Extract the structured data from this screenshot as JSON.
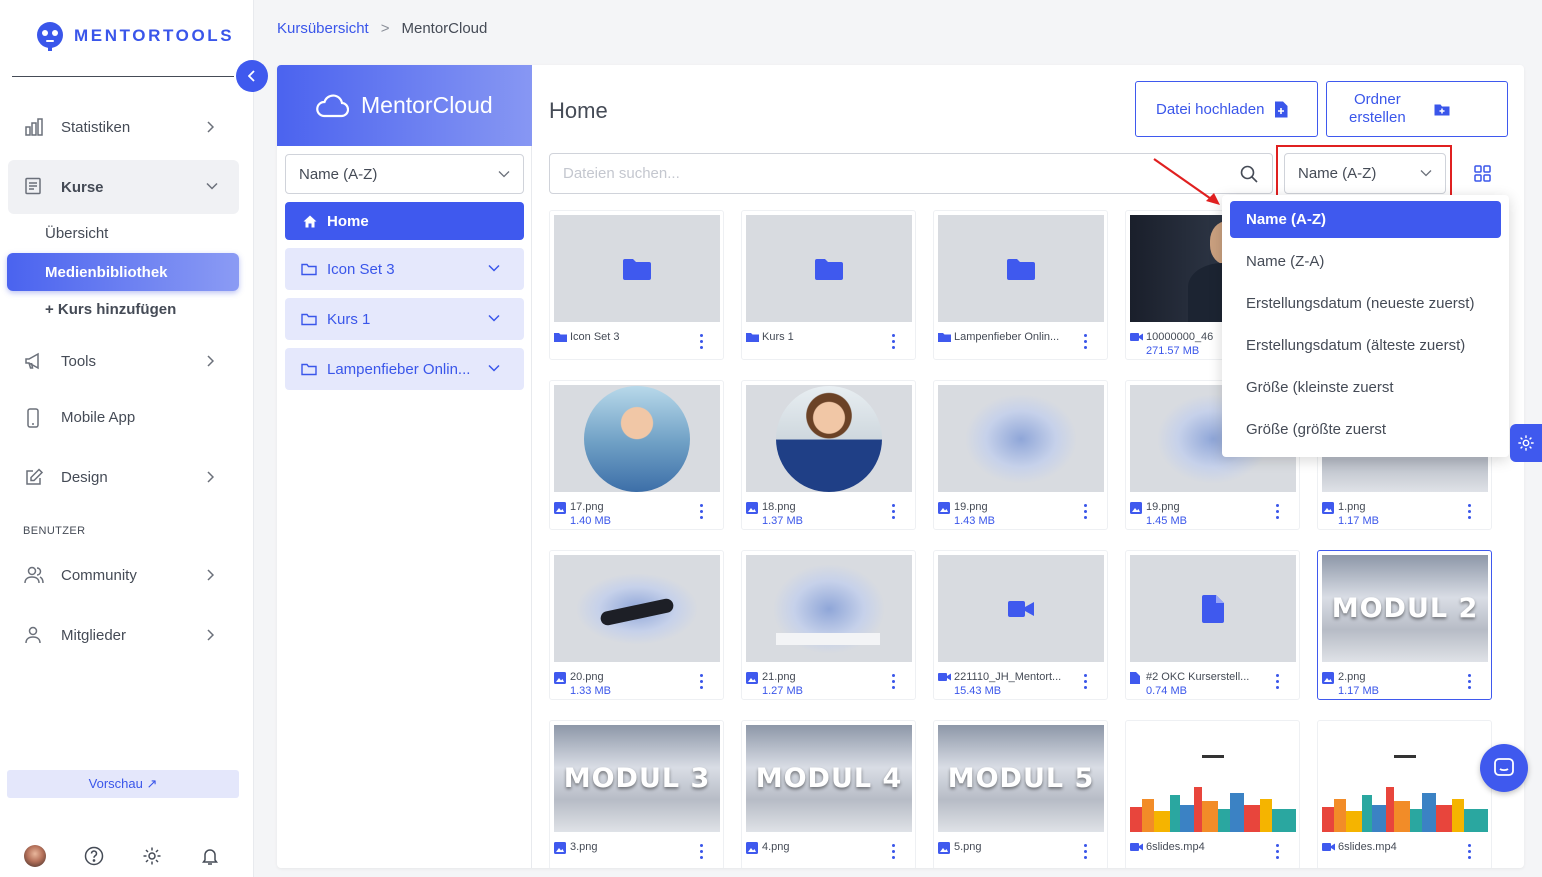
{
  "app": {
    "logo_text": "MENTORTOOLS"
  },
  "sidebar": {
    "items": [
      {
        "label": "Statistiken",
        "icon": "bar-chart-icon"
      },
      {
        "label": "Kurse",
        "icon": "book-icon"
      },
      {
        "label": "Tools",
        "icon": "megaphone-icon"
      },
      {
        "label": "Mobile App",
        "icon": "smartphone-icon"
      },
      {
        "label": "Design",
        "icon": "edit-icon"
      },
      {
        "label": "Community",
        "icon": "users-icon"
      },
      {
        "label": "Mitglieder",
        "icon": "user-icon"
      }
    ],
    "sub_items": [
      "Übersicht",
      "Medienbibliothek",
      "+ Kurs hinzufügen"
    ],
    "section_benutzer": "BENUTZER",
    "preview_label": "Vorschau ↗"
  },
  "breadcrumb": {
    "parent": "Kursübersicht",
    "separator": ">",
    "current": "MentorCloud"
  },
  "folder_panel": {
    "title": "MentorCloud",
    "sort_value": "Name (A-Z)",
    "home_label": "Home",
    "folders": [
      "Icon Set 3",
      "Kurs 1",
      "Lampenfieber Onlin..."
    ]
  },
  "content": {
    "title": "Home",
    "upload_label": "Datei hochladen",
    "create_folder_label_1": "Ordner",
    "create_folder_label_2": "erstellen",
    "search_placeholder": "Dateien suchen...",
    "sort_value": "Name (A-Z)"
  },
  "sort_options": [
    "Name (A-Z)",
    "Name (Z-A)",
    "Erstellungsdatum (neueste zuerst)",
    "Erstellungsdatum (älteste zuerst)",
    "Größe (kleinste zuerst",
    "Größe (größte zuerst"
  ],
  "files": [
    {
      "name": "Icon Set 3",
      "size": "",
      "kind": "folder"
    },
    {
      "name": "Kurs 1",
      "size": "",
      "kind": "folder"
    },
    {
      "name": "Lampenfieber Onlin...",
      "size": "",
      "kind": "folder"
    },
    {
      "name": "10000000_46",
      "size": "271.57 MB",
      "kind": "video"
    },
    {
      "name": "17.png",
      "size": "1.40 MB",
      "kind": "image"
    },
    {
      "name": "18.png",
      "size": "1.37 MB",
      "kind": "image"
    },
    {
      "name": "19.png",
      "size": "1.43 MB",
      "kind": "image"
    },
    {
      "name": "19.png",
      "size": "1.45 MB",
      "kind": "image"
    },
    {
      "name": "1.png",
      "size": "1.17 MB",
      "kind": "image"
    },
    {
      "name": "20.png",
      "size": "1.33 MB",
      "kind": "image"
    },
    {
      "name": "21.png",
      "size": "1.27 MB",
      "kind": "image"
    },
    {
      "name": "221110_JH_Mentort...",
      "size": "15.43 MB",
      "kind": "video"
    },
    {
      "name": "#2 OKC Kurserstell...",
      "size": "0.74 MB",
      "kind": "document"
    },
    {
      "name": "2.png",
      "size": "1.17 MB",
      "kind": "image",
      "overlay": "MODUL 2"
    },
    {
      "name": "3.png",
      "size": "",
      "kind": "image",
      "overlay": "MODUL 3"
    },
    {
      "name": "4.png",
      "size": "",
      "kind": "image",
      "overlay": "MODUL 4"
    },
    {
      "name": "5.png",
      "size": "",
      "kind": "image",
      "overlay": "MODUL 5"
    },
    {
      "name": "6slides.mp4",
      "size": "",
      "kind": "video"
    },
    {
      "name": "6slides.mp4",
      "size": "",
      "kind": "video"
    }
  ],
  "colors": {
    "accent": "#3f59ee",
    "highlight": "#e02020"
  }
}
